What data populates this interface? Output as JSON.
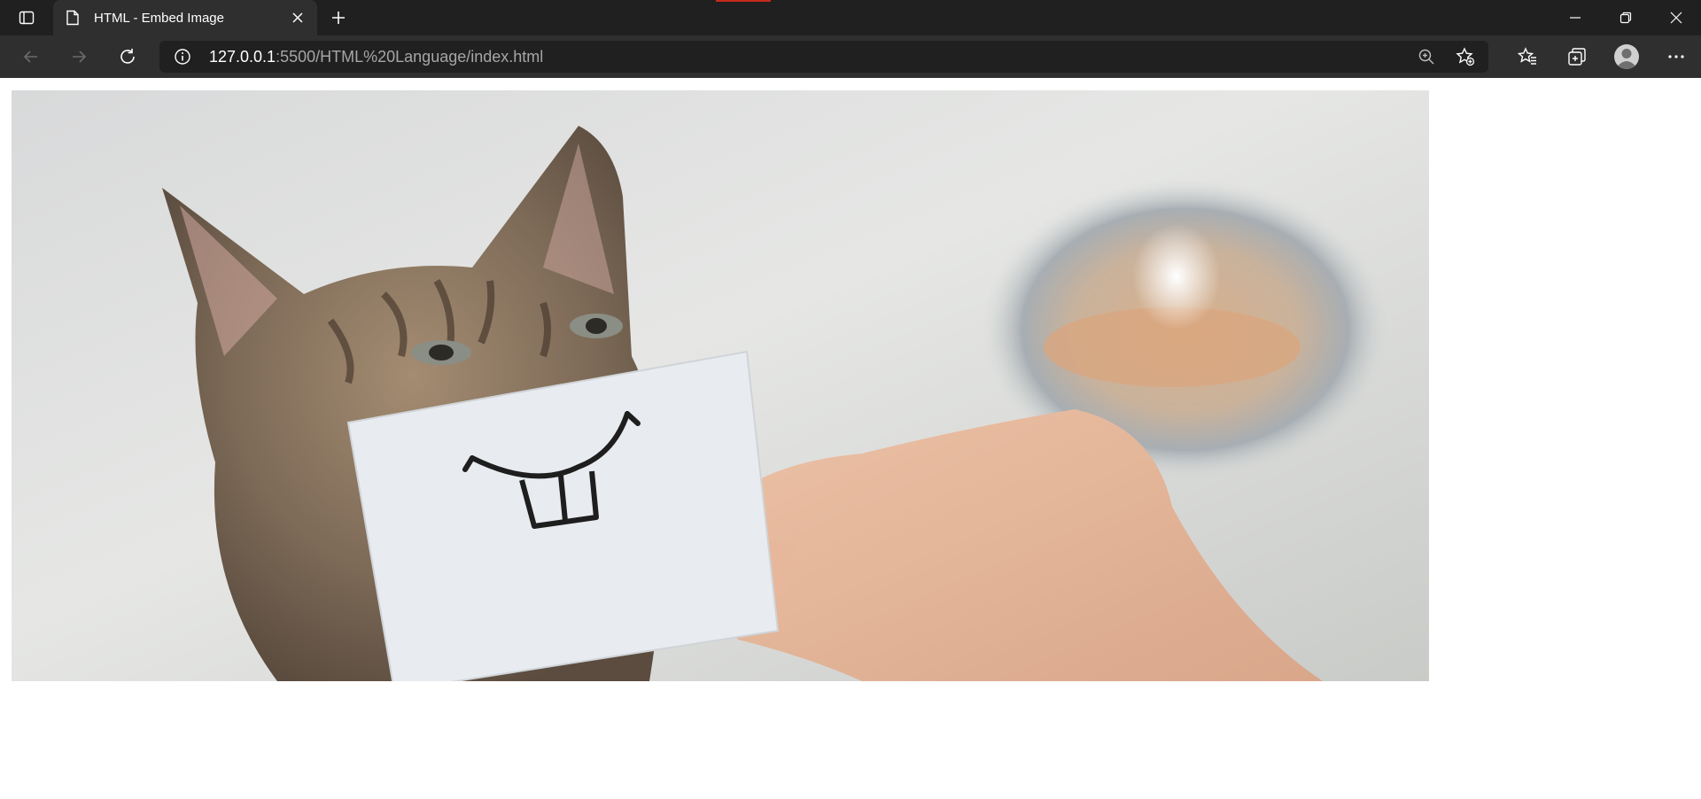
{
  "browser": {
    "tab": {
      "title": "HTML - Embed Image"
    },
    "address": {
      "host": "127.0.0.1",
      "rest": ":5500/HTML%20Language/index.html"
    },
    "accent_color": "#c42b1c"
  },
  "page": {
    "image": {
      "description_icon": "cat-photo-image"
    }
  }
}
